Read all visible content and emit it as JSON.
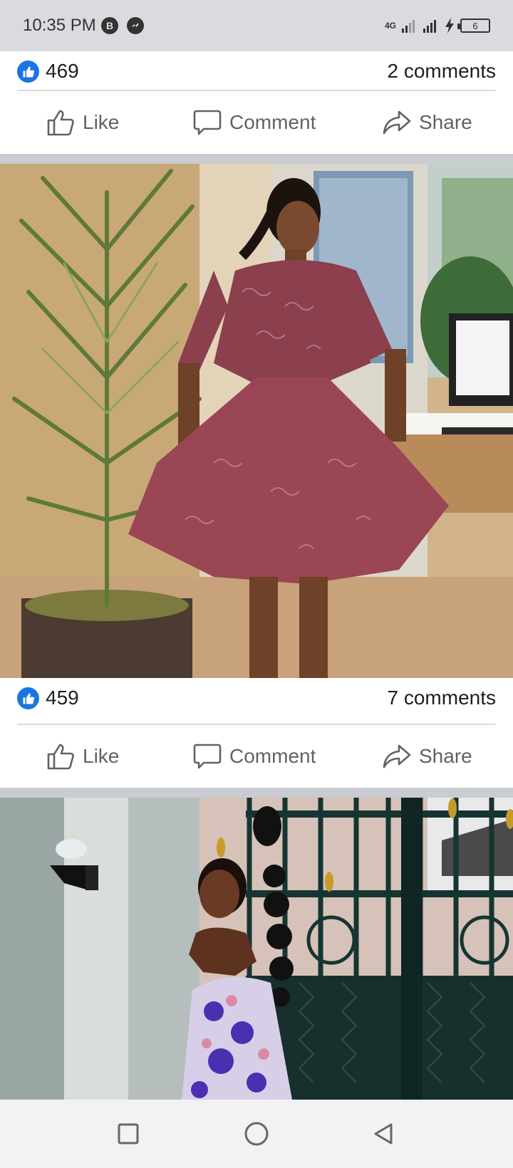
{
  "status": {
    "time": "10:35 PM",
    "network": "4G",
    "battery": "6",
    "notif_icons": [
      "b-app-icon",
      "messenger-icon"
    ]
  },
  "posts": [
    {
      "likes": "469",
      "comments": "2 comments",
      "actions": {
        "like": "Like",
        "comment": "Comment",
        "share": "Share"
      }
    },
    {
      "likes": "459",
      "comments": "7 comments",
      "actions": {
        "like": "Like",
        "comment": "Comment",
        "share": "Share"
      }
    }
  ],
  "colors": {
    "accent": "#1b74e4",
    "separator": "#c9ccd1",
    "status_bg": "#dadbdf",
    "nav_bg": "#f1f2f4"
  },
  "nav": [
    "recents-square-icon",
    "home-circle-icon",
    "back-triangle-icon"
  ]
}
